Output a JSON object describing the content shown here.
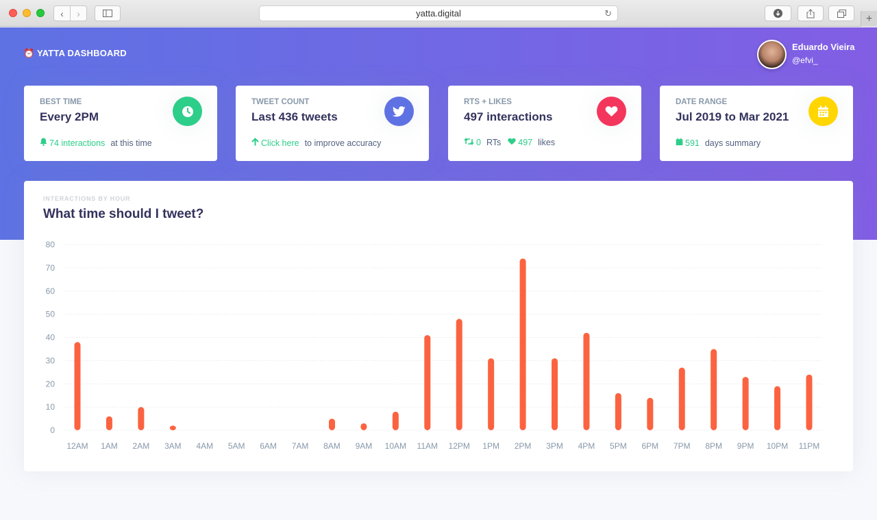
{
  "browser": {
    "url": "yatta.digital"
  },
  "header": {
    "brand": "⏰ YATTA DASHBOARD",
    "user_name": "Eduardo Vieira",
    "user_handle": "@efvi_"
  },
  "cards": [
    {
      "title": "BEST TIME",
      "value": "Every 2PM",
      "icon": "clock-icon",
      "color": "#2dce89",
      "foot_value": "74 interactions",
      "foot_text": "at this time"
    },
    {
      "title": "TWEET COUNT",
      "value": "Last 436 tweets",
      "icon": "twitter-icon",
      "color": "#5e72e4",
      "foot_value": "Click here",
      "foot_text": "to improve accuracy"
    },
    {
      "title": "RTS + LIKES",
      "value": "497 interactions",
      "icon": "heart-icon",
      "color": "#f5365c",
      "foot_rts_value": "0",
      "foot_rts_text": "RTs",
      "foot_likes_value": "497",
      "foot_likes_text": "likes"
    },
    {
      "title": "DATE RANGE",
      "value": "Jul 2019 to Mar 2021",
      "icon": "calendar-icon",
      "color": "#ffd600",
      "foot_value": "591",
      "foot_text": "days summary"
    }
  ],
  "chart": {
    "subtitle": "INTERACTIONS BY HOUR",
    "title": "What time should I tweet?"
  },
  "chart_data": {
    "type": "bar",
    "title": "What time should I tweet?",
    "categories": [
      "12AM",
      "1AM",
      "2AM",
      "3AM",
      "4AM",
      "5AM",
      "6AM",
      "7AM",
      "8AM",
      "9AM",
      "10AM",
      "11AM",
      "12PM",
      "1PM",
      "2PM",
      "3PM",
      "4PM",
      "5PM",
      "6PM",
      "7PM",
      "8PM",
      "9PM",
      "10PM",
      "11PM"
    ],
    "values": [
      38,
      6,
      10,
      2,
      0,
      0,
      0,
      0,
      5,
      3,
      8,
      41,
      48,
      31,
      74,
      31,
      42,
      16,
      14,
      27,
      35,
      23,
      19,
      24
    ],
    "ylim": [
      0,
      80
    ],
    "yticks": [
      0,
      10,
      20,
      30,
      40,
      50,
      60,
      70,
      80
    ],
    "bar_color": "#fb6340",
    "grid": true
  }
}
